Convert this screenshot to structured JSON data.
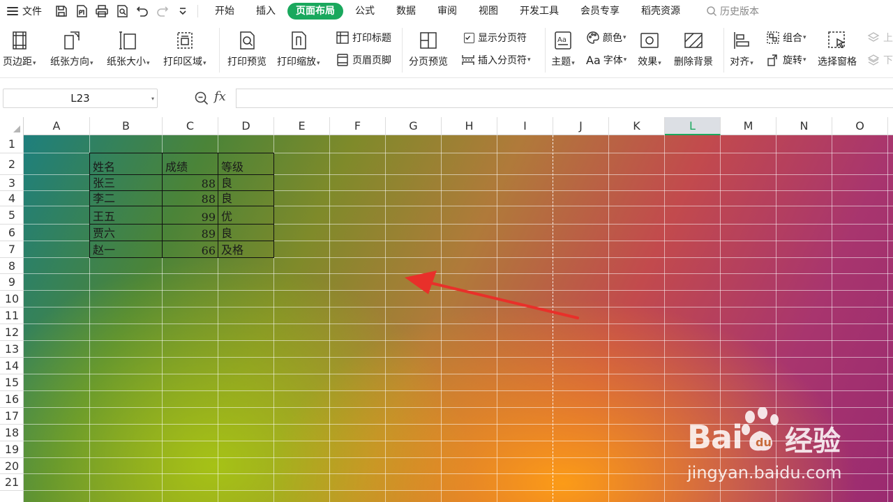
{
  "menubar": {
    "file_label": "文件",
    "quick_access": [
      "save-icon",
      "export-pdf-icon",
      "print-icon",
      "print-preview-icon",
      "undo-icon",
      "redo-icon",
      "customize-chevron-icon"
    ],
    "tabs": [
      {
        "label": "开始",
        "active": false
      },
      {
        "label": "插入",
        "active": false
      },
      {
        "label": "页面布局",
        "active": true
      },
      {
        "label": "公式",
        "active": false
      },
      {
        "label": "数据",
        "active": false
      },
      {
        "label": "审阅",
        "active": false
      },
      {
        "label": "视图",
        "active": false
      },
      {
        "label": "开发工具",
        "active": false
      },
      {
        "label": "会员专享",
        "active": false
      },
      {
        "label": "稻壳资源",
        "active": false
      }
    ],
    "history_label": "历史版本",
    "accent_color": "#1aa85d"
  },
  "ribbon": {
    "margins": "页边距",
    "orientation": "纸张方向",
    "paper_size": "纸张大小",
    "print_area": "打印区域",
    "print_preview": "打印预览",
    "print_scale": "打印缩放",
    "print_titles": "打印标题",
    "header_footer": "页眉页脚",
    "page_break_preview": "分页预览",
    "show_page_breaks": "显示分页符",
    "show_page_breaks_checked": true,
    "insert_page_break": "插入分页符",
    "theme": "主题",
    "color": "颜色",
    "font": "字体",
    "font_prefix": "Aa",
    "effects": "效果",
    "delete_background": "删除背景",
    "align": "对齐",
    "group": "组合",
    "rotate": "旋转",
    "selection_pane": "选择窗格",
    "bring_forward": "上",
    "send_backward": "下"
  },
  "formula_bar": {
    "name_box": "L23",
    "fx_label": "fx",
    "formula": ""
  },
  "sheet": {
    "columns": [
      "A",
      "B",
      "C",
      "D",
      "E",
      "F",
      "G",
      "H",
      "I",
      "J",
      "K",
      "L",
      "M",
      "N",
      "O"
    ],
    "selected_column": "L",
    "rows": [
      "1",
      "2",
      "3",
      "4",
      "5",
      "6",
      "7",
      "8",
      "9",
      "10",
      "11",
      "12",
      "13",
      "14",
      "15",
      "16",
      "17",
      "18",
      "19",
      "20",
      "21"
    ],
    "table": {
      "headers": [
        "姓名",
        "成绩",
        "等级"
      ],
      "rows": [
        {
          "name": "张三",
          "score": "88",
          "grade": "良"
        },
        {
          "name": "李二",
          "score": "88",
          "grade": "良"
        },
        {
          "name": "王五",
          "score": "99",
          "grade": "优"
        },
        {
          "name": "贾六",
          "score": "89",
          "grade": "良"
        },
        {
          "name": "赵一",
          "score": "66",
          "grade": "及格"
        }
      ]
    },
    "arrow_color": "#e8302a"
  },
  "watermark": {
    "brand": "Bai",
    "brand_cn": "经验",
    "url": "jingyan.baidu.com"
  }
}
